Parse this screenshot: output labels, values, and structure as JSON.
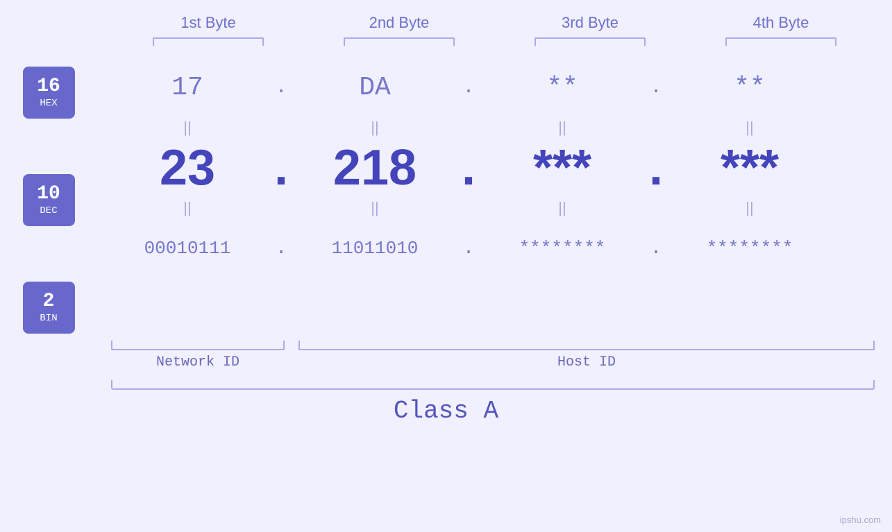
{
  "headers": {
    "byte1": "1st Byte",
    "byte2": "2nd Byte",
    "byte3": "3rd Byte",
    "byte4": "4th Byte"
  },
  "badges": [
    {
      "number": "16",
      "label": "HEX"
    },
    {
      "number": "10",
      "label": "DEC"
    },
    {
      "number": "2",
      "label": "BIN"
    }
  ],
  "hex_row": {
    "b1": "17",
    "b2": "DA",
    "b3": "**",
    "b4": "**",
    "sep": "."
  },
  "dec_row": {
    "b1": "23",
    "b2": "218",
    "b3": "***",
    "b4": "***",
    "sep": "."
  },
  "bin_row": {
    "b1": "00010111",
    "b2": "11011010",
    "b3": "********",
    "b4": "********",
    "sep": "."
  },
  "labels": {
    "network_id": "Network ID",
    "host_id": "Host ID",
    "class": "Class A"
  },
  "watermark": "ipshu.com"
}
